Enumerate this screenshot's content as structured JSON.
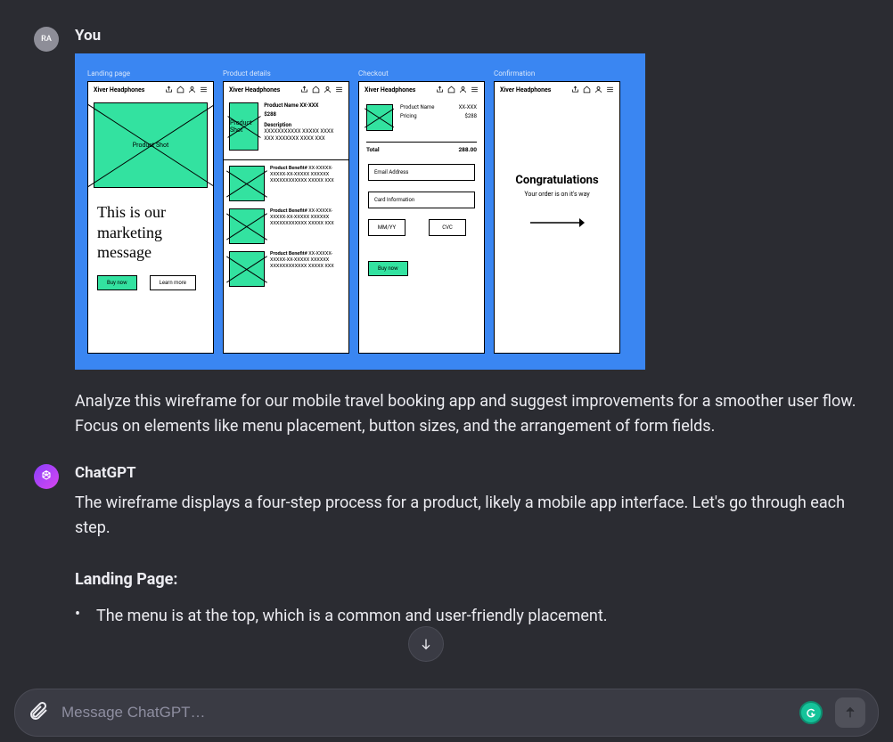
{
  "user": {
    "avatar_initials": "RA",
    "sender_label": "You",
    "prompt": "Analyze this wireframe for our mobile travel booking app and suggest improvements for a smoother user flow. Focus on elements like menu placement, button sizes, and the arrangement of form fields."
  },
  "assistant": {
    "sender_label": "ChatGPT",
    "intro": "The wireframe displays a four-step process for a product, likely a mobile app interface. Let's go through each step.",
    "section1_heading": "Landing Page:",
    "section1_bullet1": "The menu is at the top, which is a common and user-friendly placement."
  },
  "wireframe": {
    "brand": "Xiver Headphones",
    "screens": {
      "landing": {
        "label": "Landing page",
        "hero_caption": "Product Shot",
        "marketing_msg": "This is our marketing message",
        "btn_primary": "Buy now",
        "btn_secondary": "Learn more"
      },
      "product": {
        "label": "Product details",
        "hero_caption": "Product Shot",
        "name_label": "Product Name",
        "name_value": "XX-XXX",
        "price": "$288",
        "desc_label": "Description",
        "desc_body": "XXXXXXXXXXX XXXXX XXXX XXX XXXXXXX XXXX XXX",
        "benefit_label": "Product Benefit#",
        "benefit_body": "XX-XXXXX-XXXXX-XX-XXXXX XXXXXX XXXXXXXXXXXX XXXXX XXX"
      },
      "checkout": {
        "label": "Checkout",
        "name_label": "Product Name",
        "name_value": "XX-XXX",
        "price_label": "Pricing",
        "price_value": "$288",
        "total_label": "Total",
        "total_value": "288.00",
        "field_email": "Email Address",
        "field_card": "Card Information",
        "field_exp": "MM/YY",
        "field_cvc": "CVC",
        "btn_buy": "Buy now"
      },
      "confirm": {
        "label": "Confirmation",
        "title": "Congratulations",
        "subtitle": "Your order is on it's way"
      }
    }
  },
  "composer": {
    "placeholder": "Message ChatGPT…"
  }
}
